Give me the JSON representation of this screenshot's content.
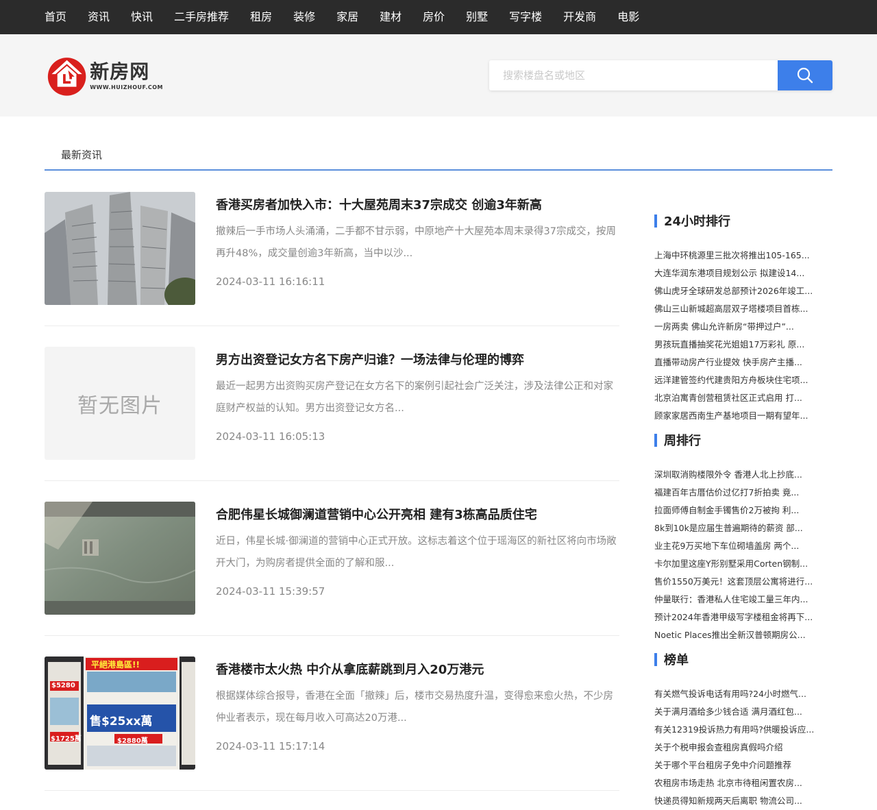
{
  "nav": [
    "首页",
    "资讯",
    "快讯",
    "二手房推荐",
    "租房",
    "装修",
    "家居",
    "建材",
    "房价",
    "别墅",
    "写字楼",
    "开发商",
    "电影"
  ],
  "logo": {
    "cn": "新房网",
    "en": "WWW.HUIZHOUF.COM",
    "brand_color": "#d9201d"
  },
  "search": {
    "placeholder": "搜索楼盘名或地区",
    "button_icon": "search-icon",
    "button_color": "#3d7fea"
  },
  "section": {
    "title": "最新资讯",
    "accent_color": "#5b8fdc"
  },
  "articles": [
    {
      "title": "香港买房者加快入市：十大屋苑周末37宗成交 创逾3年新高",
      "summary": "撤辣后一手市场人头涌涌，二手都不甘示弱，中原地产十大屋苑本周末录得37宗成交，按周再升48%，成交量创逾3年新高，当中以沙...",
      "date": "2024-03-11 16:16:11",
      "image": "high-rise-buildings-photo"
    },
    {
      "title": "男方出资登记女方名下房产归谁？一场法律与伦理的博弈",
      "summary": "最近一起男方出资购买房产登记在女方名下的案例引起社会广泛关注，涉及法律公正和对家庭财产权益的认知。男方出资登记女方名...",
      "date": "2024-03-11 16:05:13",
      "image": "placeholder",
      "placeholder_text": "暂无图片"
    },
    {
      "title": "合肥伟星长城御澜道营销中心公开亮相 建有3栋高品质住宅",
      "summary": "近日，伟星长城·御澜道的营销中心正式开放。这标志着这个位于瑶海区的新社区将向市场敞开大门，为购房者提供全面的了解和服...",
      "date": "2024-03-11 15:39:57",
      "image": "marble-wall-photo"
    },
    {
      "title": "香港楼市太火热 中介从拿底薪跳到月入20万港元",
      "summary": "根据媒体综合报导，香港在全面「撤辣」后，楼市交易热度升温，变得愈来愈火热，不少房仲业者表示，现在每月收入可高达20万港...",
      "date": "2024-03-11 15:17:14",
      "image": "real-estate-agency-window-photo",
      "image_text": {
        "banner": "平絕港島區!!",
        "big_price": "售$25xx萬",
        "price_a": "$5280",
        "price_b": "$1725萬",
        "price_c": "$2880萬"
      }
    }
  ],
  "sidebar": [
    {
      "title": "24小时排行",
      "items": [
        "上海中环桃源里三批次将推出105-165...",
        "大连华润东港项目规划公示 拟建设14...",
        "佛山虎牙全球研发总部预计2026年竣工...",
        "佛山三山新城超高层双子塔楼项目首栋...",
        "一房两卖 佛山允许新房“带押过户”...",
        "男孩玩直播抽奖花光姐姐17万彩礼 原...",
        "直播带动房产行业提效 快手房产主播...",
        "远洋建管签约代建贵阳方舟板块住宅项...",
        "北京泊寓青创营租赁社区正式启用 打...",
        "顾家家居西南生产基地项目一期有望年..."
      ]
    },
    {
      "title": "周排行",
      "items": [
        "深圳取消购楼限外令 香港人北上抄底...",
        "福建百年古厝估价过亿打7折拍卖 竟...",
        "拉面师傅自制金手镯售价2万被拘 利...",
        "8k到10k是应届生普遍期待的薪资 部...",
        "业主花9万买地下车位砌墙盖房 两个...",
        "卡尔加里这座Y形别墅采用Corten钢制...",
        "售价1550万美元！这套顶层公寓将进行...",
        "仲量联行：香港私人住宅竣工量三年内...",
        "预计2024年香港甲级写字楼租金将再下...",
        "Noetic Places推出全新汉普顿期房公..."
      ]
    },
    {
      "title": "榜单",
      "items": [
        "有关燃气投诉电话有用吗?24小时燃气...",
        "关于满月酒给多少钱合适 满月酒红包...",
        "有关12319投诉热力有用吗?供暖投诉应...",
        "关于个税申报会查租房真假吗介绍",
        "关于哪个平台租房子免中介问题推荐",
        "农租房市场走热 北京市待租闲置农房...",
        "快递员得知新规两天后离职 物流公司..."
      ]
    }
  ]
}
